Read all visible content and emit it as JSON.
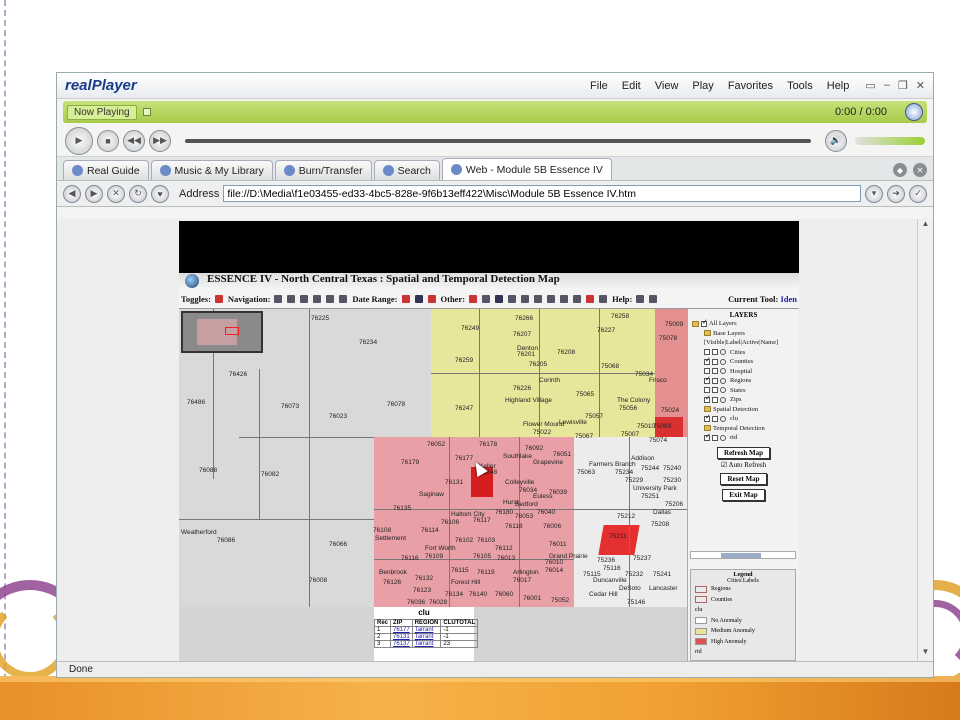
{
  "app": {
    "logo": "realPlayer",
    "menus": [
      "File",
      "Edit",
      "View",
      "Play",
      "Favorites",
      "Tools",
      "Help"
    ],
    "now_playing": "Now Playing",
    "time": "0:00 / 0:00",
    "tabs": [
      {
        "label": "Real Guide"
      },
      {
        "label": "Music & My Library"
      },
      {
        "label": "Burn/Transfer"
      },
      {
        "label": "Search"
      },
      {
        "label": "Web - Module 5B Essence IV"
      }
    ],
    "address_label": "Address",
    "address_value": "file://D:\\Media\\f1e03455-ed33-4bc5-828e-9f6b13eff422\\Misc\\Module 5B Essence IV.htm",
    "status": "Done"
  },
  "essence": {
    "title": "ESSENCE IV - North Central Texas : Spatial and Temporal Detection Map",
    "toolbar": {
      "toggles": "Toggles:",
      "navigation": "Navigation:",
      "date_range": "Date Range:",
      "other": "Other:",
      "help": "Help:",
      "current_tool_label": "Current Tool:",
      "current_tool_value": "Iden"
    },
    "layers": {
      "title": "LAYERS",
      "all": "All Layers",
      "base": "Base Layers",
      "header": "[Visible|Label|Active|Name]",
      "base_items": [
        "Cities",
        "Counties",
        "Hospital",
        "Regions",
        "States",
        "Zips"
      ],
      "spatial": "Spatial Detection",
      "spatial_items": [
        "clu"
      ],
      "temporal": "Temporal Detection",
      "temporal_items": [
        "rtd"
      ],
      "refresh": "Refresh Map",
      "auto_refresh": "Auto Refresh",
      "reset": "Reset Map",
      "exit": "Exit Map"
    },
    "legend": {
      "title": "Legend",
      "subtitle": "Cities:Labels",
      "items": [
        "Regions",
        "Counties",
        "clu",
        "No Anomaly",
        "Medium Anomaly",
        "High Anomaly",
        "rtd"
      ]
    },
    "clu": {
      "title": "clu",
      "headers": [
        "Rec",
        "ZIP",
        "REGION",
        "CLUTOTAL"
      ],
      "rows": [
        [
          "1",
          "76177",
          "Tarrant",
          "-1"
        ],
        [
          "2",
          "76131",
          "Tarrant",
          "-1"
        ],
        [
          "3",
          "76137",
          "Tarrant",
          "23"
        ]
      ]
    },
    "map_labels": {
      "zips_gray": [
        "76225",
        "76234",
        "76426",
        "76486",
        "76073",
        "76023",
        "76078",
        "76088",
        "76082",
        "76066",
        "76008",
        "76086"
      ],
      "zips_yellow": [
        "76266",
        "76258",
        "76249",
        "76207",
        "76227",
        "76201",
        "76208",
        "76259",
        "76205",
        "75068",
        "75034",
        "76226",
        "76247",
        "75065",
        "75022",
        "75057",
        "75056",
        "75067",
        "75007",
        "75010",
        "75009",
        "75078",
        "75024"
      ],
      "cities_yellow": [
        "Denton",
        "Corinth",
        "Highland Village",
        "Lewisville",
        "Flower Mound",
        "The Colony",
        "Frisco"
      ],
      "zips_pink": [
        "76052",
        "76178",
        "76092",
        "76051",
        "76179",
        "76177",
        "76248",
        "76131",
        "76034",
        "76039",
        "76135",
        "76106",
        "76117",
        "76180",
        "76053",
        "76040",
        "76108",
        "76114",
        "76118",
        "76006",
        "76102",
        "76103",
        "76011",
        "76116",
        "76112",
        "76109",
        "76105",
        "76013",
        "76010",
        "76126",
        "76132",
        "76115",
        "76119",
        "76017",
        "76014",
        "76123",
        "76134",
        "76140",
        "76060",
        "76001",
        "76036",
        "76028",
        "75052"
      ],
      "cities_pink": [
        "Keller",
        "Southlake",
        "Grapevine",
        "Colleyville",
        "Saginaw",
        "Hurst",
        "Euless",
        "Bedford",
        "Haltom City",
        "Settlement",
        "Fort Worth",
        "Arlington",
        "Benbrook",
        "Forest Hill",
        "Grand Prairie"
      ],
      "zips_white": [
        "75093",
        "75074",
        "75063",
        "75234",
        "75244",
        "75240",
        "75229",
        "75230",
        "75251",
        "75206",
        "75212",
        "75211",
        "75208",
        "75236",
        "75116",
        "75237",
        "75115",
        "75232",
        "75241",
        "75146"
      ],
      "cities_white": [
        "Farmers Branch",
        "Addison",
        "University Park",
        "Dallas",
        "Duncanville",
        "DeSoto",
        "Cedar Hill",
        "Lancaster"
      ]
    }
  }
}
